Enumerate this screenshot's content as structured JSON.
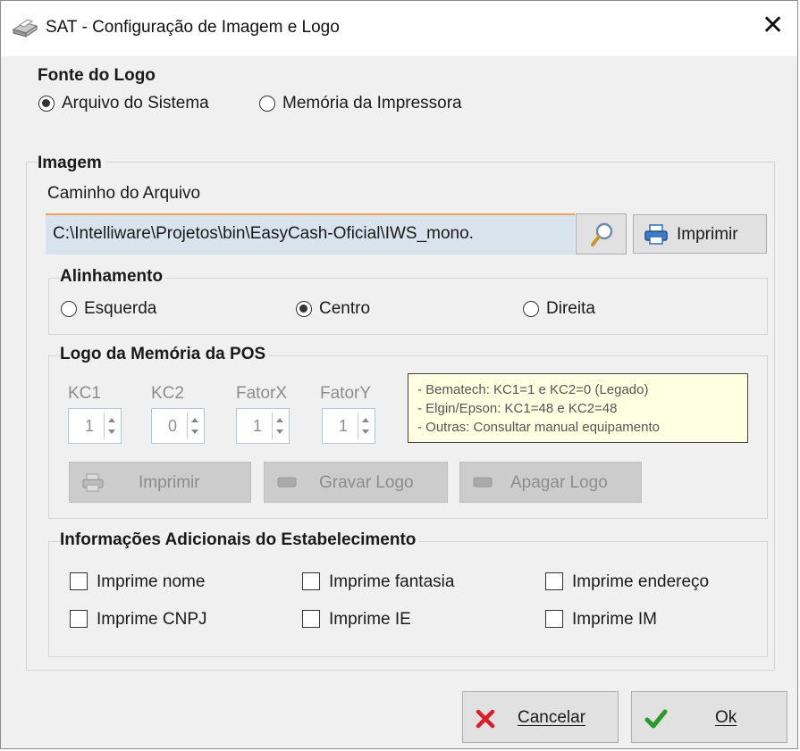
{
  "window": {
    "title": "SAT - Configuração de Imagem e Logo"
  },
  "fonte_logo": {
    "legend": "Fonte do Logo",
    "options": [
      {
        "label": "Arquivo do Sistema",
        "selected": true
      },
      {
        "label": "Memória da Impressora",
        "selected": false
      }
    ]
  },
  "imagem": {
    "legend": "Imagem",
    "path_label": "Caminho do Arquivo",
    "path_value": "C:\\Intelliware\\Projetos\\bin\\EasyCash-Oficial\\IWS_mono.",
    "print_label": "Imprimir"
  },
  "alinhamento": {
    "legend": "Alinhamento",
    "options": [
      {
        "label": "Esquerda",
        "selected": false
      },
      {
        "label": "Centro",
        "selected": true
      },
      {
        "label": "Direita",
        "selected": false
      }
    ]
  },
  "logo_pos": {
    "legend": "Logo da Memória da POS",
    "fields": [
      {
        "label": "KC1",
        "value": "1"
      },
      {
        "label": "KC2",
        "value": "0"
      },
      {
        "label": "FatorX",
        "value": "1"
      },
      {
        "label": "FatorY",
        "value": "1"
      }
    ],
    "info": [
      "- Bematech: KC1=1 e KC2=0 (Legado)",
      "- Elgin/Epson: KC1=48 e KC2=48",
      "- Outras: Consultar manual equipamento"
    ],
    "buttons": {
      "print": "Imprimir",
      "save": "Gravar Logo",
      "erase": "Apagar Logo"
    }
  },
  "info_adicionais": {
    "legend": "Informações Adicionais do Estabelecimento",
    "checks": [
      {
        "label": "Imprime nome",
        "checked": false
      },
      {
        "label": "Imprime fantasia",
        "checked": false
      },
      {
        "label": "Imprime endereço",
        "checked": false
      },
      {
        "label": "Imprime CNPJ",
        "checked": false
      },
      {
        "label": "Imprime IE",
        "checked": false
      },
      {
        "label": "Imprime IM",
        "checked": false
      }
    ]
  },
  "footer": {
    "cancel_label": "Cancelar",
    "ok_label": "Ok"
  },
  "colors": {
    "cancel_icon": "#d9202a",
    "ok_icon": "#2a9a2a",
    "path_accent": "#f2a15d"
  }
}
